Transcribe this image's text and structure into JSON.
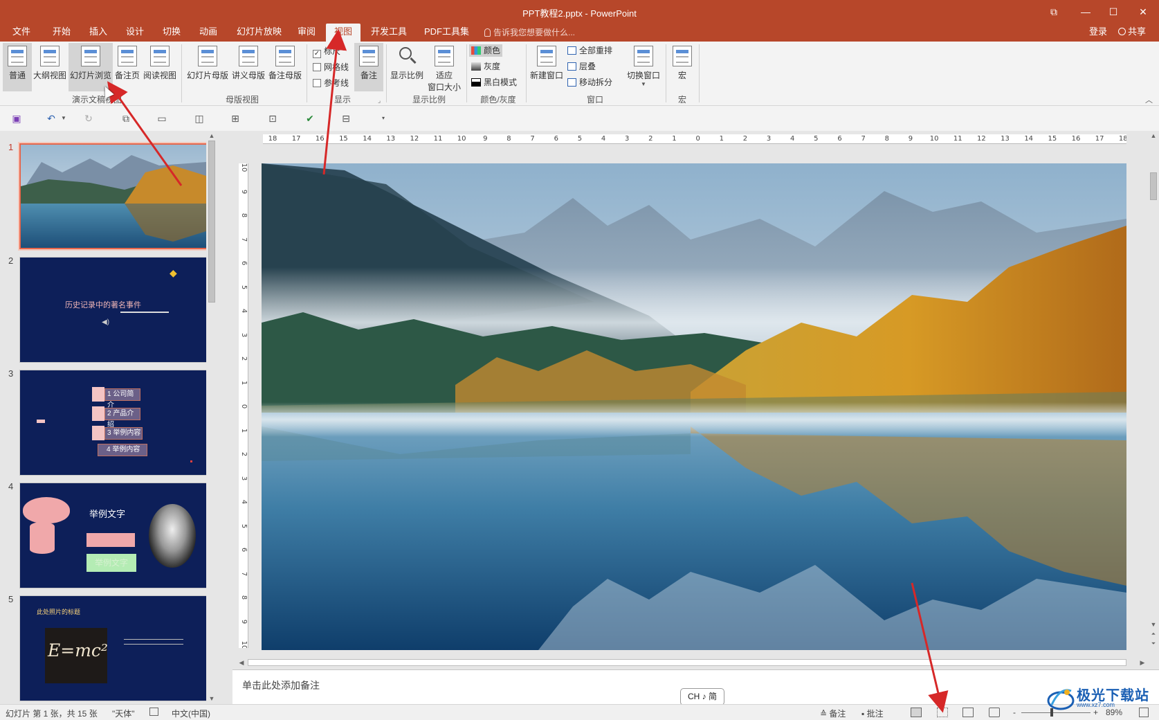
{
  "window": {
    "title": "PPT教程2.pptx - PowerPoint",
    "controls": {
      "restore": "⧉",
      "minimize": "—",
      "maximize": "☐",
      "close": "✕"
    }
  },
  "menu": {
    "tabs": [
      "文件",
      "开始",
      "插入",
      "设计",
      "切换",
      "动画",
      "幻灯片放映",
      "审阅",
      "视图",
      "开发工具",
      "PDF工具集"
    ],
    "active_tab": "视图",
    "tell_me_placeholder": "告诉我您想要做什么...",
    "login": "登录",
    "share": "共享"
  },
  "ribbon": {
    "presentation_views": {
      "label": "演示文稿视图",
      "buttons": [
        "普通",
        "大纲视图",
        "幻灯片浏览",
        "备注页",
        "阅读视图"
      ]
    },
    "master_views": {
      "label": "母版视图",
      "buttons": [
        "幻灯片母版",
        "讲义母版",
        "备注母版"
      ]
    },
    "show": {
      "label": "显示",
      "checkboxes": [
        {
          "label": "标尺",
          "checked": true
        },
        {
          "label": "网格线",
          "checked": false
        },
        {
          "label": "参考线",
          "checked": false
        }
      ],
      "notes_button": "备注"
    },
    "zoom": {
      "label": "显示比例",
      "zoom_button": "显示比例",
      "fit_button_line1": "适应",
      "fit_button_line2": "窗口大小"
    },
    "color": {
      "label": "颜色/灰度",
      "items": [
        "颜色",
        "灰度",
        "黑白模式"
      ]
    },
    "window": {
      "label": "窗口",
      "new_window": "新建窗口",
      "items": [
        "全部重排",
        "层叠",
        "移动拆分"
      ],
      "switch_window": "切换窗口"
    },
    "macro": {
      "label": "宏",
      "button": "宏"
    }
  },
  "slides_pane": {
    "slides": [
      {
        "number": "1"
      },
      {
        "number": "2",
        "title": "历史记录中的著名事件"
      },
      {
        "number": "3",
        "items": [
          "1 公司简介",
          "2 产品介绍",
          "3 举例内容",
          "4 举例内容"
        ]
      },
      {
        "number": "4",
        "title": "举例文字",
        "box_text": "举例文字"
      },
      {
        "number": "5",
        "title": "此处照片的标题",
        "formula": "E=mc²"
      }
    ],
    "selected": "1"
  },
  "rulers": {
    "horizontal": [
      "18",
      "17",
      "16",
      "15",
      "14",
      "13",
      "12",
      "11",
      "10",
      "9",
      "8",
      "7",
      "6",
      "5",
      "4",
      "3",
      "2",
      "1",
      "0",
      "1",
      "2",
      "3",
      "4",
      "5",
      "6",
      "7",
      "8",
      "9",
      "10",
      "11",
      "12",
      "13",
      "14",
      "15",
      "16",
      "17",
      "18"
    ],
    "vertical": [
      "10",
      "9",
      "8",
      "7",
      "6",
      "5",
      "4",
      "3",
      "2",
      "1",
      "0",
      "1",
      "2",
      "3",
      "4",
      "5",
      "6",
      "7",
      "8",
      "9",
      "10"
    ]
  },
  "notes": {
    "placeholder": "单击此处添加备注"
  },
  "ime": {
    "text": "CH ♪ 简"
  },
  "statusbar": {
    "slide_info": "幻灯片 第 1 张，共 15 张",
    "theme": "\"天体\"",
    "language": "中文(中国)",
    "notes": "备注",
    "comments": "批注",
    "zoom_minus": "-",
    "zoom_plus": "+",
    "zoom_level": "89%"
  },
  "watermark": {
    "text": "极光下载站",
    "sub": "www.xz7.com"
  },
  "colors": {
    "accent": "#b7472a",
    "arrow": "#d62828",
    "slide_bg": "#0d1f59"
  }
}
